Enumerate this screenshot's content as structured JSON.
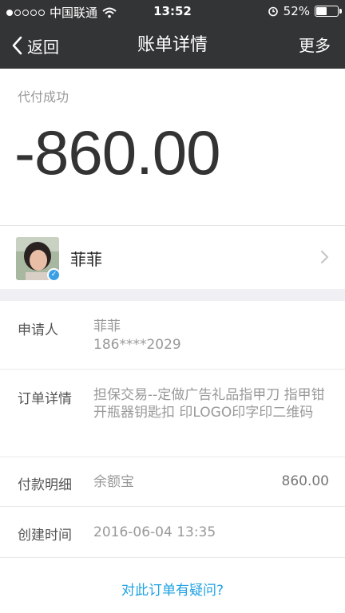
{
  "status_bar": {
    "carrier": "中国联通",
    "time": "13:52",
    "battery": "52%",
    "battery_level": 0.52
  },
  "nav": {
    "back_label": "返回",
    "title": "账单详情",
    "more_label": "更多"
  },
  "summary": {
    "status": "代付成功",
    "amount": "-860.00"
  },
  "payer": {
    "name": "菲菲"
  },
  "details": {
    "requester": {
      "label": "申请人",
      "name": "菲菲",
      "phone": "186****2029"
    },
    "order": {
      "label": "订单详情",
      "value": "担保交易--定做广告礼品指甲刀 指甲钳 开瓶器钥匙扣 印LOGO印字印二维码"
    },
    "payment": {
      "label": "付款明细",
      "method": "余额宝",
      "amount": "860.00"
    },
    "created": {
      "label": "创建时间",
      "value": "2016-06-04 13:35"
    }
  },
  "question_link": "对此订单有疑问?"
}
